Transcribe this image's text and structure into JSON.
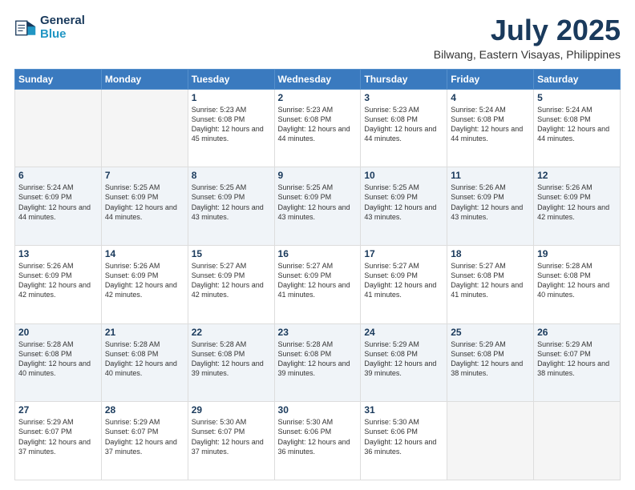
{
  "header": {
    "logo_line1": "General",
    "logo_line2": "Blue",
    "title": "July 2025",
    "subtitle": "Bilwang, Eastern Visayas, Philippines"
  },
  "days_of_week": [
    "Sunday",
    "Monday",
    "Tuesday",
    "Wednesday",
    "Thursday",
    "Friday",
    "Saturday"
  ],
  "weeks": [
    {
      "shaded": false,
      "days": [
        {
          "num": "",
          "info": ""
        },
        {
          "num": "",
          "info": ""
        },
        {
          "num": "1",
          "info": "Sunrise: 5:23 AM\nSunset: 6:08 PM\nDaylight: 12 hours and 45 minutes."
        },
        {
          "num": "2",
          "info": "Sunrise: 5:23 AM\nSunset: 6:08 PM\nDaylight: 12 hours and 44 minutes."
        },
        {
          "num": "3",
          "info": "Sunrise: 5:23 AM\nSunset: 6:08 PM\nDaylight: 12 hours and 44 minutes."
        },
        {
          "num": "4",
          "info": "Sunrise: 5:24 AM\nSunset: 6:08 PM\nDaylight: 12 hours and 44 minutes."
        },
        {
          "num": "5",
          "info": "Sunrise: 5:24 AM\nSunset: 6:08 PM\nDaylight: 12 hours and 44 minutes."
        }
      ]
    },
    {
      "shaded": true,
      "days": [
        {
          "num": "6",
          "info": "Sunrise: 5:24 AM\nSunset: 6:09 PM\nDaylight: 12 hours and 44 minutes."
        },
        {
          "num": "7",
          "info": "Sunrise: 5:25 AM\nSunset: 6:09 PM\nDaylight: 12 hours and 44 minutes."
        },
        {
          "num": "8",
          "info": "Sunrise: 5:25 AM\nSunset: 6:09 PM\nDaylight: 12 hours and 43 minutes."
        },
        {
          "num": "9",
          "info": "Sunrise: 5:25 AM\nSunset: 6:09 PM\nDaylight: 12 hours and 43 minutes."
        },
        {
          "num": "10",
          "info": "Sunrise: 5:25 AM\nSunset: 6:09 PM\nDaylight: 12 hours and 43 minutes."
        },
        {
          "num": "11",
          "info": "Sunrise: 5:26 AM\nSunset: 6:09 PM\nDaylight: 12 hours and 43 minutes."
        },
        {
          "num": "12",
          "info": "Sunrise: 5:26 AM\nSunset: 6:09 PM\nDaylight: 12 hours and 42 minutes."
        }
      ]
    },
    {
      "shaded": false,
      "days": [
        {
          "num": "13",
          "info": "Sunrise: 5:26 AM\nSunset: 6:09 PM\nDaylight: 12 hours and 42 minutes."
        },
        {
          "num": "14",
          "info": "Sunrise: 5:26 AM\nSunset: 6:09 PM\nDaylight: 12 hours and 42 minutes."
        },
        {
          "num": "15",
          "info": "Sunrise: 5:27 AM\nSunset: 6:09 PM\nDaylight: 12 hours and 42 minutes."
        },
        {
          "num": "16",
          "info": "Sunrise: 5:27 AM\nSunset: 6:09 PM\nDaylight: 12 hours and 41 minutes."
        },
        {
          "num": "17",
          "info": "Sunrise: 5:27 AM\nSunset: 6:09 PM\nDaylight: 12 hours and 41 minutes."
        },
        {
          "num": "18",
          "info": "Sunrise: 5:27 AM\nSunset: 6:08 PM\nDaylight: 12 hours and 41 minutes."
        },
        {
          "num": "19",
          "info": "Sunrise: 5:28 AM\nSunset: 6:08 PM\nDaylight: 12 hours and 40 minutes."
        }
      ]
    },
    {
      "shaded": true,
      "days": [
        {
          "num": "20",
          "info": "Sunrise: 5:28 AM\nSunset: 6:08 PM\nDaylight: 12 hours and 40 minutes."
        },
        {
          "num": "21",
          "info": "Sunrise: 5:28 AM\nSunset: 6:08 PM\nDaylight: 12 hours and 40 minutes."
        },
        {
          "num": "22",
          "info": "Sunrise: 5:28 AM\nSunset: 6:08 PM\nDaylight: 12 hours and 39 minutes."
        },
        {
          "num": "23",
          "info": "Sunrise: 5:28 AM\nSunset: 6:08 PM\nDaylight: 12 hours and 39 minutes."
        },
        {
          "num": "24",
          "info": "Sunrise: 5:29 AM\nSunset: 6:08 PM\nDaylight: 12 hours and 39 minutes."
        },
        {
          "num": "25",
          "info": "Sunrise: 5:29 AM\nSunset: 6:08 PM\nDaylight: 12 hours and 38 minutes."
        },
        {
          "num": "26",
          "info": "Sunrise: 5:29 AM\nSunset: 6:07 PM\nDaylight: 12 hours and 38 minutes."
        }
      ]
    },
    {
      "shaded": false,
      "days": [
        {
          "num": "27",
          "info": "Sunrise: 5:29 AM\nSunset: 6:07 PM\nDaylight: 12 hours and 37 minutes."
        },
        {
          "num": "28",
          "info": "Sunrise: 5:29 AM\nSunset: 6:07 PM\nDaylight: 12 hours and 37 minutes."
        },
        {
          "num": "29",
          "info": "Sunrise: 5:30 AM\nSunset: 6:07 PM\nDaylight: 12 hours and 37 minutes."
        },
        {
          "num": "30",
          "info": "Sunrise: 5:30 AM\nSunset: 6:06 PM\nDaylight: 12 hours and 36 minutes."
        },
        {
          "num": "31",
          "info": "Sunrise: 5:30 AM\nSunset: 6:06 PM\nDaylight: 12 hours and 36 minutes."
        },
        {
          "num": "",
          "info": ""
        },
        {
          "num": "",
          "info": ""
        }
      ]
    }
  ]
}
